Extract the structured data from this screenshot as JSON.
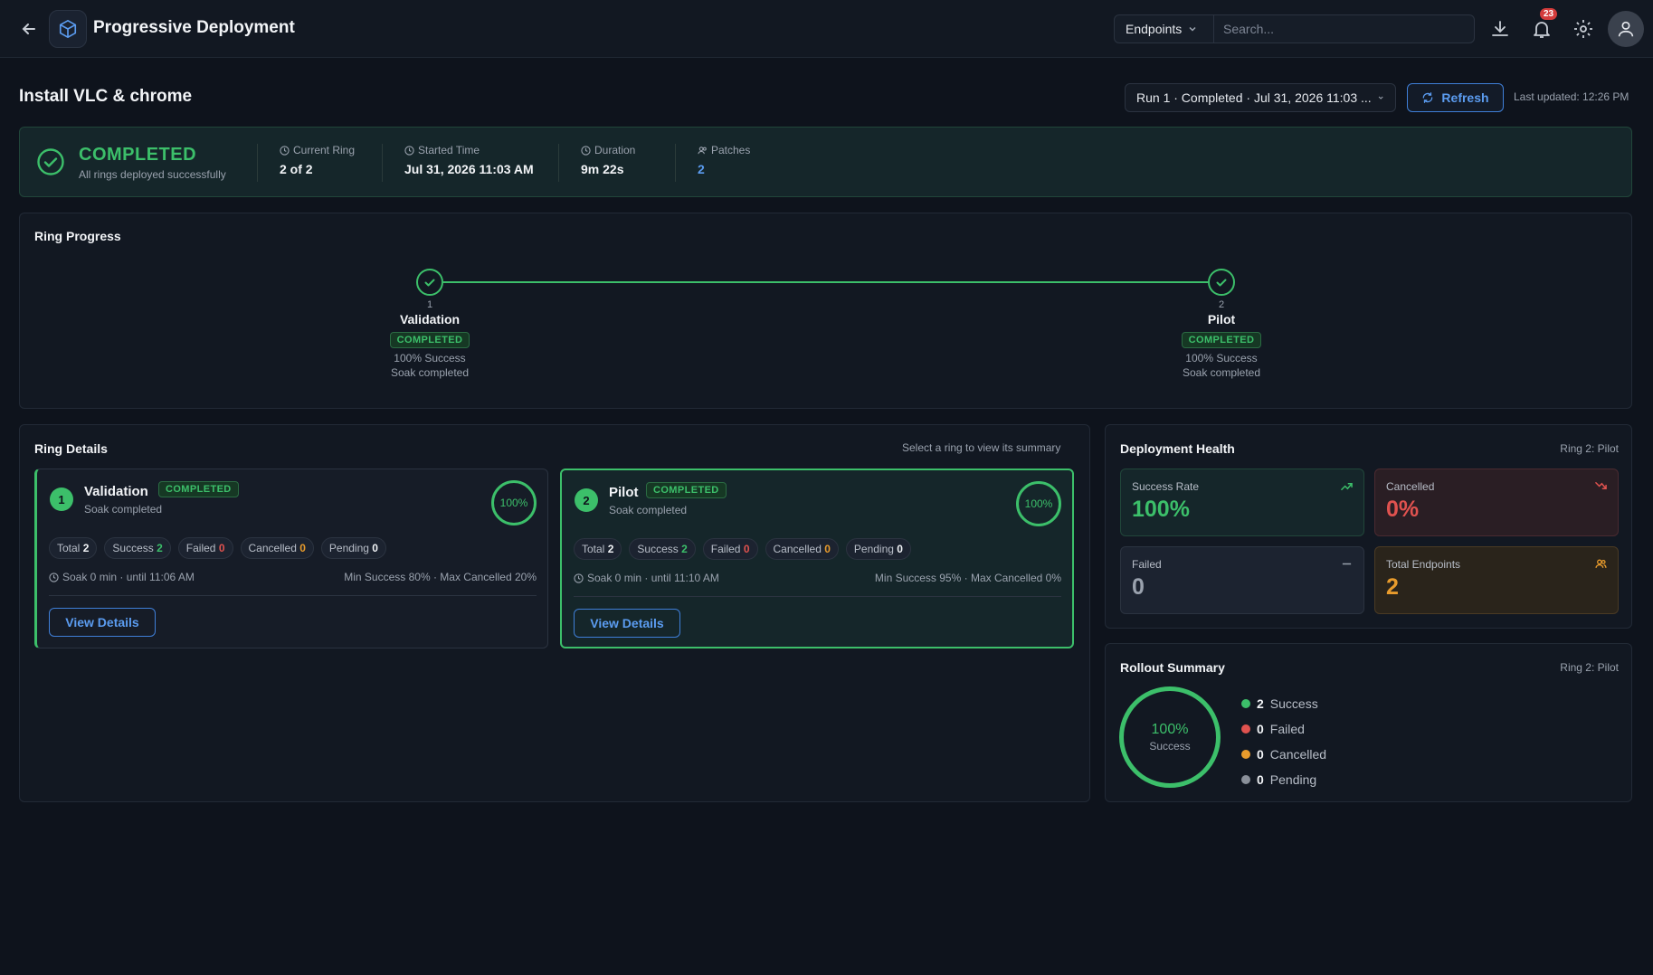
{
  "app": {
    "title": "Progressive Deployment"
  },
  "topbar": {
    "scope": "Endpoints",
    "search_placeholder": "Search...",
    "notification_count": "23"
  },
  "page": {
    "title": "Install VLC & chrome",
    "run_select": "Run 1 · Completed · Jul 31, 2026 11:03 ...",
    "refresh_label": "Refresh",
    "last_updated": "Last updated: 12:26 PM"
  },
  "banner": {
    "status": "COMPLETED",
    "subtitle": "All rings deployed successfully",
    "stats": [
      {
        "label": "Current Ring",
        "value": "2 of 2"
      },
      {
        "label": "Started Time",
        "value": "Jul 31, 2026 11:03 AM"
      },
      {
        "label": "Duration",
        "value": "9m 22s"
      },
      {
        "label": "Patches",
        "value": "2"
      }
    ]
  },
  "ring_progress": {
    "title": "Ring Progress",
    "rings": [
      {
        "num": "1",
        "name": "Validation",
        "status": "COMPLETED",
        "success": "100% Success",
        "soak": "Soak completed"
      },
      {
        "num": "2",
        "name": "Pilot",
        "status": "COMPLETED",
        "success": "100% Success",
        "soak": "Soak completed"
      }
    ]
  },
  "ring_details": {
    "title": "Ring Details",
    "hint": "Select a ring to view its summary",
    "cards": [
      {
        "num": "1",
        "name": "Validation",
        "status": "COMPLETED",
        "sub": "Soak completed",
        "pct": "100%",
        "chips": {
          "total_label": "Total",
          "total": "2",
          "success_label": "Success",
          "success": "2",
          "failed_label": "Failed",
          "failed": "0",
          "cancelled_label": "Cancelled",
          "cancelled": "0",
          "pending_label": "Pending",
          "pending": "0"
        },
        "soak": "Soak 0 min · until 11:06 AM",
        "thresholds": "Min Success 80% · Max Cancelled 20%",
        "button": "View Details"
      },
      {
        "num": "2",
        "name": "Pilot",
        "status": "COMPLETED",
        "sub": "Soak completed",
        "pct": "100%",
        "chips": {
          "total_label": "Total",
          "total": "2",
          "success_label": "Success",
          "success": "2",
          "failed_label": "Failed",
          "failed": "0",
          "cancelled_label": "Cancelled",
          "cancelled": "0",
          "pending_label": "Pending",
          "pending": "0"
        },
        "soak": "Soak 0 min · until 11:10 AM",
        "thresholds": "Min Success 95% · Max Cancelled 0%",
        "button": "View Details"
      }
    ]
  },
  "health": {
    "title": "Deployment Health",
    "ring": "Ring 2: Pilot",
    "metrics": [
      {
        "label": "Success Rate",
        "value": "100%"
      },
      {
        "label": "Cancelled",
        "value": "0%"
      },
      {
        "label": "Failed",
        "value": "0"
      },
      {
        "label": "Total Endpoints",
        "value": "2"
      }
    ]
  },
  "rollout": {
    "title": "Rollout Summary",
    "ring": "Ring 2: Pilot",
    "donut_pct": "100%",
    "donut_label": "Success",
    "legend": [
      {
        "count": "2",
        "label": "Success",
        "color": "#3cbf6a"
      },
      {
        "count": "0",
        "label": "Failed",
        "color": "#e0524f"
      },
      {
        "count": "0",
        "label": "Cancelled",
        "color": "#e89b2c"
      },
      {
        "count": "0",
        "label": "Pending",
        "color": "#8a909a"
      }
    ]
  }
}
